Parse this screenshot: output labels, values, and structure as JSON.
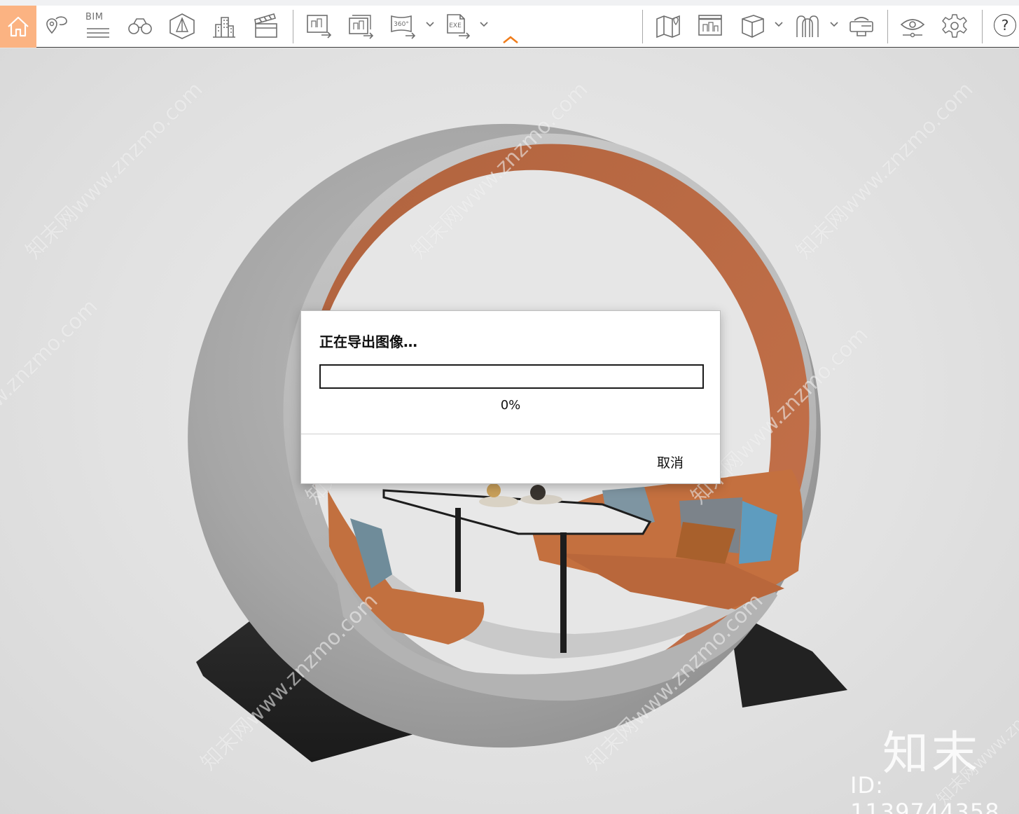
{
  "toolbar": {
    "bim_label": "BIM",
    "help_label": "?",
    "accent_color": "#fbb382",
    "icons": [
      "home-icon",
      "location-pin-icon",
      "bim-icon",
      "binoculars-icon",
      "pyramid-icon",
      "buildings-icon",
      "clapperboard-icon",
      "export-image-icon",
      "export-batch-icon",
      "export-360-icon",
      "export-exe-icon",
      "collapse-icon",
      "map-icon",
      "screen-icon",
      "box-icon",
      "figures-icon",
      "vr-headset-icon",
      "visibility-icon",
      "settings-icon",
      "help-icon"
    ],
    "export_360_label": "360°",
    "export_exe_label": "EXE"
  },
  "watermarks": {
    "site": "知末网www.znzmo.com",
    "brand": "知末",
    "id_text": "ID: 1139744358"
  },
  "dialog": {
    "title": "正在导出图像…",
    "progress": 0,
    "progress_text": "0%",
    "cancel_label": "取消"
  }
}
